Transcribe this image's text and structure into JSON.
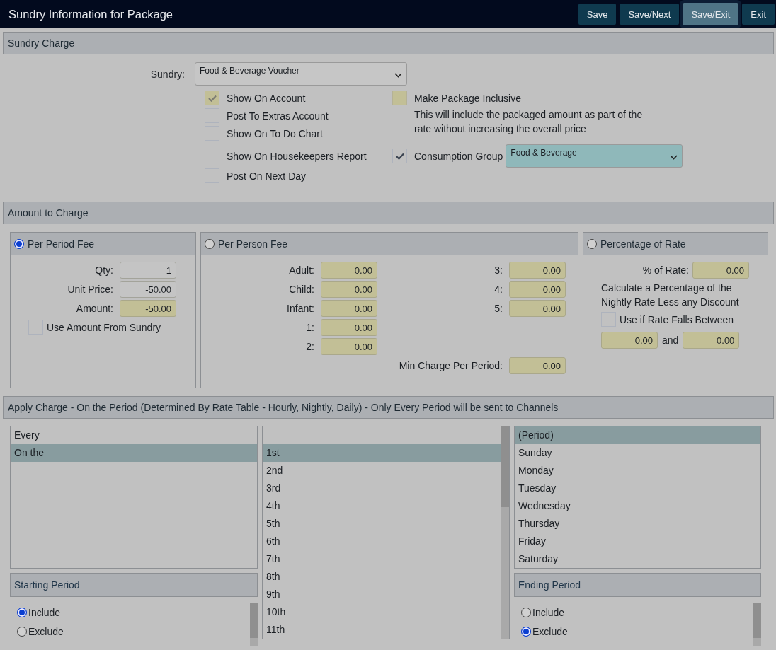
{
  "window": {
    "title": "Sundry Information for Package"
  },
  "toolbar": [
    {
      "label": "Save",
      "selected": false
    },
    {
      "label": "Save/Next",
      "selected": false
    },
    {
      "label": "Save/Exit",
      "selected": true
    },
    {
      "label": "Exit",
      "selected": false
    }
  ],
  "sundry_charge": {
    "heading": "Sundry Charge",
    "sundry": {
      "label": "Sundry:",
      "value": "Food & Beverage Voucher"
    },
    "options": [
      {
        "label": "Show On Account",
        "checked": true,
        "disabled": true
      },
      {
        "label": "Post To Extras Account",
        "checked": false,
        "disabled": false
      },
      {
        "label": "Show On To Do Chart",
        "checked": false,
        "disabled": false
      },
      {
        "label": "Show On Housekeepers Report",
        "checked": false,
        "disabled": false
      },
      {
        "label": "Post On Next Day",
        "checked": false,
        "disabled": false
      }
    ],
    "package_inclusive": {
      "label": "Make Package Inclusive",
      "checked": false,
      "disabled": true,
      "note": "This will include the packaged amount as part of the rate without increasing the overall price"
    },
    "consumption_group": {
      "label": "Consumption Group",
      "checked": true,
      "disabled": false,
      "value": "Food & Beverage"
    }
  },
  "amount_to_charge": {
    "heading": "Amount to Charge",
    "per_period": {
      "title": "Per Period Fee",
      "selected": true,
      "fields": [
        {
          "label": "Qty:",
          "value": "1",
          "kind": "readonly"
        },
        {
          "label": "Unit Price:",
          "value": "-50.00",
          "kind": "readonly"
        },
        {
          "label": "Amount:",
          "value": "-50.00",
          "kind": "entry"
        }
      ],
      "use_amount": {
        "label": "Use Amount From Sundry",
        "checked": false,
        "disabled": false
      }
    },
    "per_person": {
      "title": "Per Person Fee",
      "selected": false,
      "fields_left": [
        {
          "label": "Adult:",
          "value": "0.00",
          "kind": "entry"
        },
        {
          "label": "Child:",
          "value": "0.00",
          "kind": "entry"
        },
        {
          "label": "Infant:",
          "value": "0.00",
          "kind": "entry"
        },
        {
          "label": "1:",
          "value": "0.00",
          "kind": "entry"
        },
        {
          "label": "2:",
          "value": "0.00",
          "kind": "entry"
        }
      ],
      "fields_right": [
        {
          "label": "3:",
          "value": "0.00",
          "kind": "entry"
        },
        {
          "label": "4:",
          "value": "0.00",
          "kind": "entry"
        },
        {
          "label": "5:",
          "value": "0.00",
          "kind": "entry"
        }
      ],
      "min_charge": {
        "label": "Min Charge Per Period:",
        "value": "0.00",
        "kind": "entry"
      }
    },
    "percentage": {
      "title": "Percentage of Rate",
      "selected": false,
      "rate": {
        "label": "% of Rate:",
        "value": "0.00",
        "kind": "entry"
      },
      "note": "Calculate a Percentage of the Nightly Rate Less any Discount",
      "use_if": {
        "label": "Use if Rate Falls Between",
        "checked": false,
        "disabled": false
      },
      "range_from": {
        "value": "0.00",
        "kind": "entry"
      },
      "range_joiner": "and",
      "range_to": {
        "value": "0.00",
        "kind": "entry"
      }
    }
  },
  "apply_charge": {
    "heading": "Apply Charge - On the Period (Determined By Rate Table - Hourly, Nightly, Daily) - Only Every Period will be sent to Channels",
    "frequency": [
      {
        "label": "Every",
        "selected": false
      },
      {
        "label": "On the",
        "selected": true
      }
    ],
    "ordinals": [
      {
        "label": "1st",
        "selected": true
      },
      {
        "label": "2nd",
        "selected": false
      },
      {
        "label": "3rd",
        "selected": false
      },
      {
        "label": "4th",
        "selected": false
      },
      {
        "label": "5th",
        "selected": false
      },
      {
        "label": "6th",
        "selected": false
      },
      {
        "label": "7th",
        "selected": false
      },
      {
        "label": "8th",
        "selected": false
      },
      {
        "label": "9th",
        "selected": false
      },
      {
        "label": "10th",
        "selected": false
      },
      {
        "label": "11th",
        "selected": false
      }
    ],
    "periods": [
      {
        "label": "(Period)",
        "selected": true
      },
      {
        "label": "Sunday",
        "selected": false
      },
      {
        "label": "Monday",
        "selected": false
      },
      {
        "label": "Tuesday",
        "selected": false
      },
      {
        "label": "Wednesday",
        "selected": false
      },
      {
        "label": "Thursday",
        "selected": false
      },
      {
        "label": "Friday",
        "selected": false
      },
      {
        "label": "Saturday",
        "selected": false
      }
    ],
    "starting_period": {
      "heading": "Starting Period",
      "options": [
        {
          "label": "Include",
          "selected": true
        },
        {
          "label": "Exclude",
          "selected": false
        }
      ]
    },
    "ending_period": {
      "heading": "Ending Period",
      "options": [
        {
          "label": "Include",
          "selected": false
        },
        {
          "label": "Exclude",
          "selected": true
        }
      ]
    }
  }
}
